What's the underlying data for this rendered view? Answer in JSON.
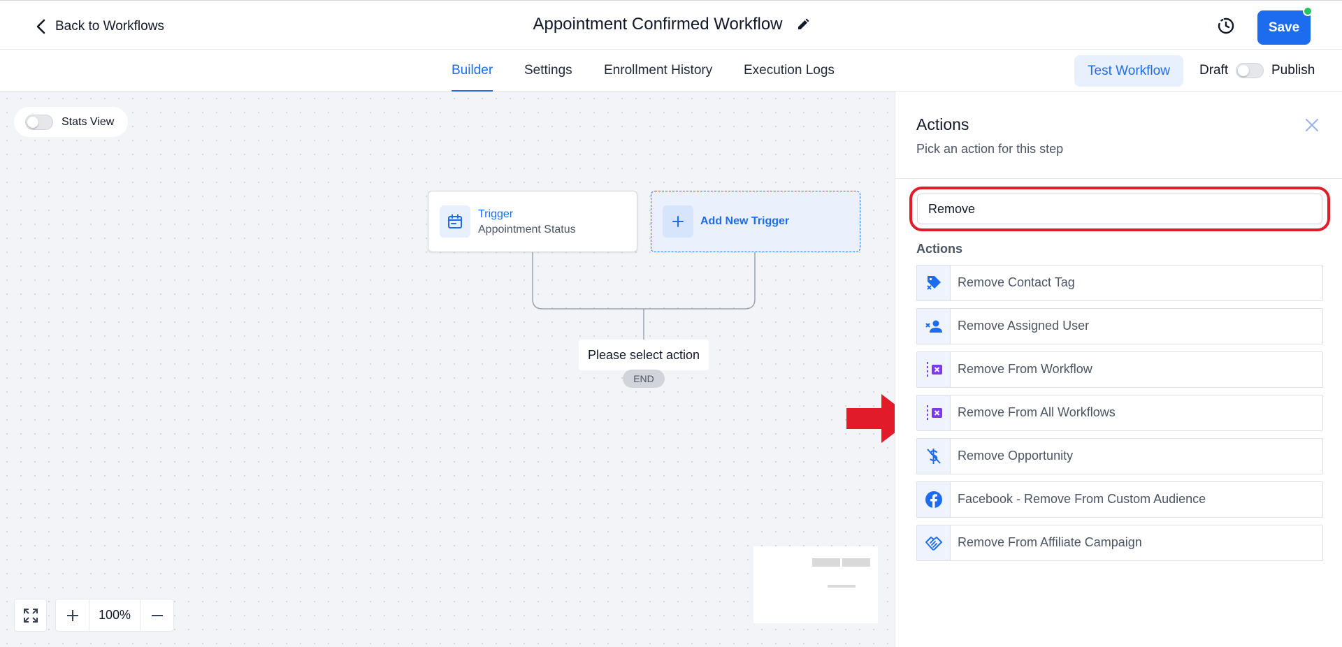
{
  "header": {
    "back_label": "Back to Workflows",
    "workflow_title": "Appointment Confirmed Workflow",
    "save_label": "Save"
  },
  "tabs": [
    {
      "label": "Builder",
      "active": true
    },
    {
      "label": "Settings",
      "active": false
    },
    {
      "label": "Enrollment History",
      "active": false
    },
    {
      "label": "Execution Logs",
      "active": false
    }
  ],
  "toolbar": {
    "test_label": "Test Workflow",
    "draft_label": "Draft",
    "publish_label": "Publish",
    "published": false
  },
  "canvas": {
    "stats_view_label": "Stats View",
    "stats_view_on": false,
    "trigger": {
      "title": "Trigger",
      "subtitle": "Appointment Status"
    },
    "add_trigger_label": "Add New Trigger",
    "select_action_label": "Please select action",
    "end_label": "END",
    "zoom_level": "100%"
  },
  "panel": {
    "title": "Actions",
    "subtitle": "Pick an action for this step",
    "search_value": "Remove",
    "section_label": "Actions",
    "actions": [
      {
        "label": "Remove Contact Tag",
        "icon": "tag-remove-icon"
      },
      {
        "label": "Remove Assigned User",
        "icon": "user-remove-icon"
      },
      {
        "label": "Remove From Workflow",
        "icon": "workflow-remove-icon"
      },
      {
        "label": "Remove From All Workflows",
        "icon": "workflow-remove-all-icon"
      },
      {
        "label": "Remove Opportunity",
        "icon": "dollar-off-icon"
      },
      {
        "label": "Facebook - Remove From Custom Audience",
        "icon": "facebook-icon"
      },
      {
        "label": "Remove From Affiliate Campaign",
        "icon": "handshake-icon"
      }
    ]
  },
  "colors": {
    "accent": "#1d6cf0",
    "highlight_red": "#e21b2a",
    "status_green": "#22c55e",
    "workflow_icon_purple": "#7c3aed"
  }
}
